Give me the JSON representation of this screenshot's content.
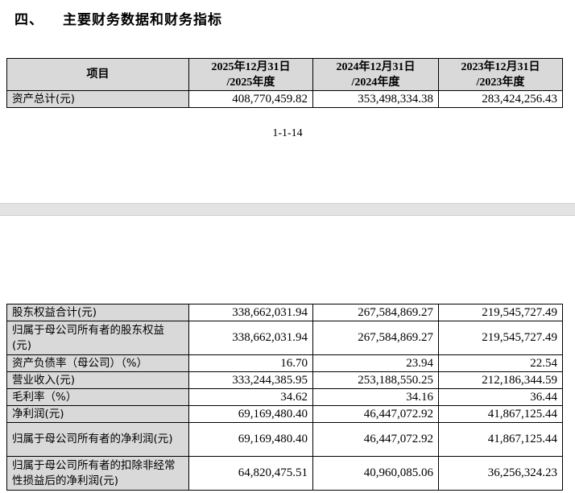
{
  "section": {
    "number": "四、",
    "title": "主要财务数据和财务指标"
  },
  "columns": {
    "item": "项目",
    "c1_line1": "2025年12月31日",
    "c1_line2": "/2025年度",
    "c2_line1": "2024年12月31日",
    "c2_line2": "/2024年度",
    "c3_line1": "2023年12月31日",
    "c3_line2": "/2023年度"
  },
  "page1_rows": [
    {
      "label": "资产总计(元)",
      "v2025": "408,770,459.82",
      "v2024": "353,498,334.38",
      "v2023": "283,424,256.43"
    }
  ],
  "page_number": "1-1-14",
  "page2_rows": [
    {
      "label": "股东权益合计(元)",
      "v2025": "338,662,031.94",
      "v2024": "267,584,869.27",
      "v2023": "219,545,727.49"
    },
    {
      "label": "归属于母公司所有者的股东权益(元)",
      "v2025": "338,662,031.94",
      "v2024": "267,584,869.27",
      "v2023": "219,545,727.49"
    },
    {
      "label": "资产负债率（母公司）（%）",
      "v2025": "16.70",
      "v2024": "23.94",
      "v2023": "22.54"
    },
    {
      "label": "营业收入(元)",
      "v2025": "333,244,385.95",
      "v2024": "253,188,550.25",
      "v2023": "212,186,344.59"
    },
    {
      "label": "毛利率（%）",
      "v2025": "34.62",
      "v2024": "34.16",
      "v2023": "36.44"
    },
    {
      "label": "净利润(元)",
      "v2025": "69,169,480.40",
      "v2024": "46,447,072.92",
      "v2023": "41,867,125.44"
    },
    {
      "label": "归属于母公司所有者的净利润(元)",
      "v2025": "69,169,480.40",
      "v2024": "46,447,072.92",
      "v2023": "41,867,125.44"
    },
    {
      "label": "归属于母公司所有者的扣除非经常性损益后的净利润(元)",
      "v2025": "64,820,475.51",
      "v2024": "40,960,085.06",
      "v2023": "36,256,324.23"
    }
  ]
}
